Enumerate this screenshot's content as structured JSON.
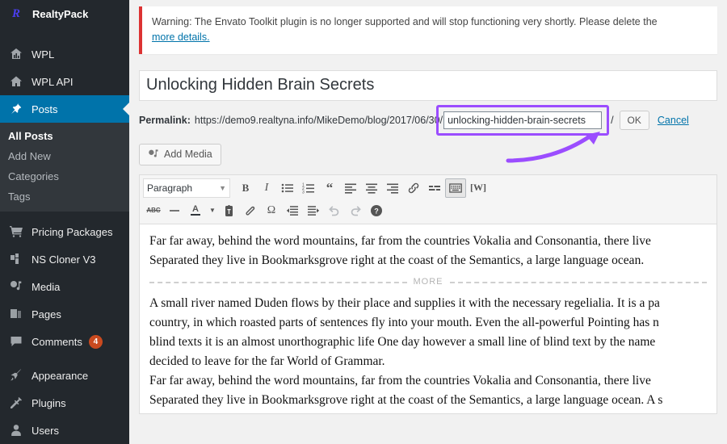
{
  "sidebar": {
    "brand": {
      "label": "RealtyPack",
      "logo_glyph": "R",
      "logo_color": "#4b3ef0"
    },
    "active_color": "#0073aa",
    "badge_color": "#ca4a1f",
    "items": [
      {
        "label": "WPL",
        "icon": "chart-house-icon",
        "active": false
      },
      {
        "label": "WPL API",
        "icon": "home-icon",
        "active": false
      },
      {
        "label": "Posts",
        "icon": "pin-icon",
        "active": true
      },
      {
        "label": "Pricing Packages",
        "icon": "cart-icon",
        "active": false
      },
      {
        "label": "NS Cloner V3",
        "icon": "clone-blocks-icon",
        "active": false
      },
      {
        "label": "Media",
        "icon": "media-icon",
        "active": false
      },
      {
        "label": "Pages",
        "icon": "pages-icon",
        "active": false
      },
      {
        "label": "Comments",
        "icon": "comment-icon",
        "active": false,
        "badge": "4"
      },
      {
        "label": "Appearance",
        "icon": "brush-icon",
        "active": false
      },
      {
        "label": "Plugins",
        "icon": "plug-icon",
        "active": false
      },
      {
        "label": "Users",
        "icon": "user-icon",
        "active": false
      }
    ],
    "posts_submenu": [
      {
        "label": "All Posts",
        "current": true
      },
      {
        "label": "Add New",
        "current": false
      },
      {
        "label": "Categories",
        "current": false
      },
      {
        "label": "Tags",
        "current": false
      }
    ]
  },
  "notice": {
    "text": "Warning: The Envato Toolkit plugin is no longer supported and will stop functioning very shortly. Please delete the",
    "link_text": "more details.",
    "accent_color": "#dc3232",
    "link_color": "#0073aa"
  },
  "post": {
    "title_value": "Unlocking Hidden Brain Secrets",
    "title_placeholder": "Enter title here",
    "permalink_label": "Permalink:",
    "permalink_base": "https://demo9.realtyna.info/MikeDemo/blog/2017/06/30/",
    "slug_value": "unlocking-hidden-brain-secrets",
    "slug_suffix": "/",
    "ok_label": "OK",
    "cancel_label": "Cancel",
    "highlight_color": "#9b4dff"
  },
  "editor": {
    "add_media_label": "Add Media",
    "format_select": "Paragraph",
    "toolbar_row1": [
      {
        "name": "bold-icon",
        "glyph": "B"
      },
      {
        "name": "italic-icon",
        "glyph": "I"
      },
      {
        "name": "bulleted-list-icon",
        "glyph": ""
      },
      {
        "name": "numbered-list-icon",
        "glyph": ""
      },
      {
        "name": "blockquote-icon",
        "glyph": "“"
      },
      {
        "name": "align-left-icon",
        "glyph": ""
      },
      {
        "name": "align-center-icon",
        "glyph": ""
      },
      {
        "name": "align-right-icon",
        "glyph": ""
      },
      {
        "name": "insert-link-icon",
        "glyph": ""
      },
      {
        "name": "read-more-icon",
        "glyph": ""
      },
      {
        "name": "toggle-toolbar-icon",
        "glyph": ""
      },
      {
        "name": "wordpress-w-icon",
        "glyph": "[W]"
      }
    ],
    "toolbar_row2": [
      {
        "name": "strikethrough-icon",
        "glyph": "ABC"
      },
      {
        "name": "horizontal-line-icon",
        "glyph": ""
      },
      {
        "name": "text-color-icon",
        "glyph": "A"
      },
      {
        "name": "text-color-dropdown-icon",
        "glyph": ""
      },
      {
        "name": "paste-as-text-icon",
        "glyph": ""
      },
      {
        "name": "clear-formatting-icon",
        "glyph": ""
      },
      {
        "name": "special-character-icon",
        "glyph": "Ω"
      },
      {
        "name": "decrease-indent-icon",
        "glyph": ""
      },
      {
        "name": "increase-indent-icon",
        "glyph": ""
      },
      {
        "name": "undo-icon",
        "glyph": ""
      },
      {
        "name": "redo-icon",
        "glyph": ""
      },
      {
        "name": "keyboard-shortcuts-icon",
        "glyph": "?"
      }
    ],
    "more_divider_label": "MORE",
    "body_paragraphs": [
      "Far far away, behind the word mountains, far from the countries Vokalia and Consonantia, there live",
      "Separated they live in Bookmarksgrove right at the coast of the Semantics, a large language ocean."
    ],
    "body_paragraphs_after_more": [
      "A small river named Duden flows by their place and supplies it with the necessary regelialia. It is a pa",
      "country, in which roasted parts of sentences fly into your mouth. Even the all-powerful Pointing has n",
      "blind texts it is an almost unorthographic life One day however a small line of blind text by the name",
      "decided to leave for the far World of Grammar.",
      "Far far away, behind the word mountains, far from the countries Vokalia and Consonantia, there live",
      "Separated they live in Bookmarksgrove right at the coast of the Semantics, a large language ocean. A s"
    ]
  }
}
